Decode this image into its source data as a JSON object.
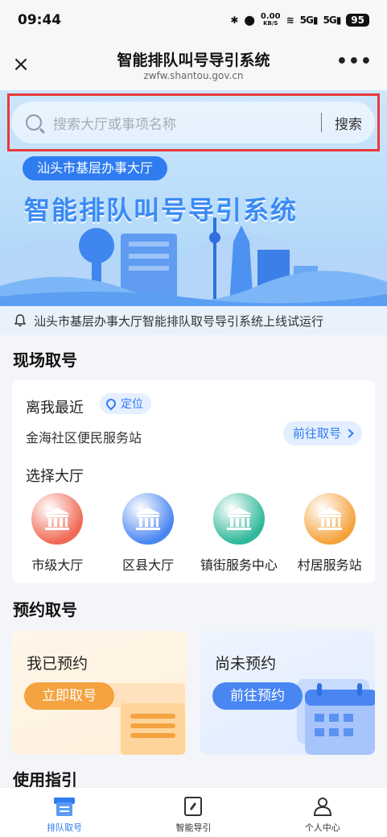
{
  "status_bar": {
    "time": "09:44",
    "net_speed": "0.00",
    "net_speed_unit": "KB/S",
    "signal1": "5G",
    "signal2": "5G",
    "battery": "95"
  },
  "nav": {
    "title": "智能排队叫号导引系统",
    "url": "zwfw.shantou.gov.cn",
    "close_icon": "×",
    "more_icon": "•••"
  },
  "search": {
    "placeholder": "搜索大厅或事项名称",
    "button": "搜索"
  },
  "banner": {
    "pill": "汕头市基层办事大厅",
    "title": "智能排队叫号导引系统"
  },
  "notice": {
    "text": "汕头市基层办事大厅智能排队取号导引系统上线试运行"
  },
  "onsite": {
    "section_title": "现场取号",
    "nearest_label": "离我最近",
    "locate_label": "定位",
    "station_name": "金海社区便民服务站",
    "go_button": "前往取号",
    "select_label": "选择大厅",
    "halls": [
      {
        "label": "市级大厅",
        "color": "#ef6a55"
      },
      {
        "label": "区县大厅",
        "color": "#4a86f2"
      },
      {
        "label": "镇街服务中心",
        "color": "#2fb89a"
      },
      {
        "label": "村居服务站",
        "color": "#f5a23c"
      }
    ]
  },
  "reservation": {
    "section_title": "预约取号",
    "reserved_title": "我已预约",
    "reserved_button": "立即取号",
    "unreserved_title": "尚未预约",
    "unreserved_button": "前往预约"
  },
  "guide": {
    "section_title": "使用指引"
  },
  "tabs": [
    {
      "label": "排队取号",
      "active": true
    },
    {
      "label": "智能导引",
      "active": false
    },
    {
      "label": "个人中心",
      "active": false
    }
  ],
  "colors": {
    "accent": "#2f7cf0",
    "highlight_outline": "#e83a3a"
  }
}
